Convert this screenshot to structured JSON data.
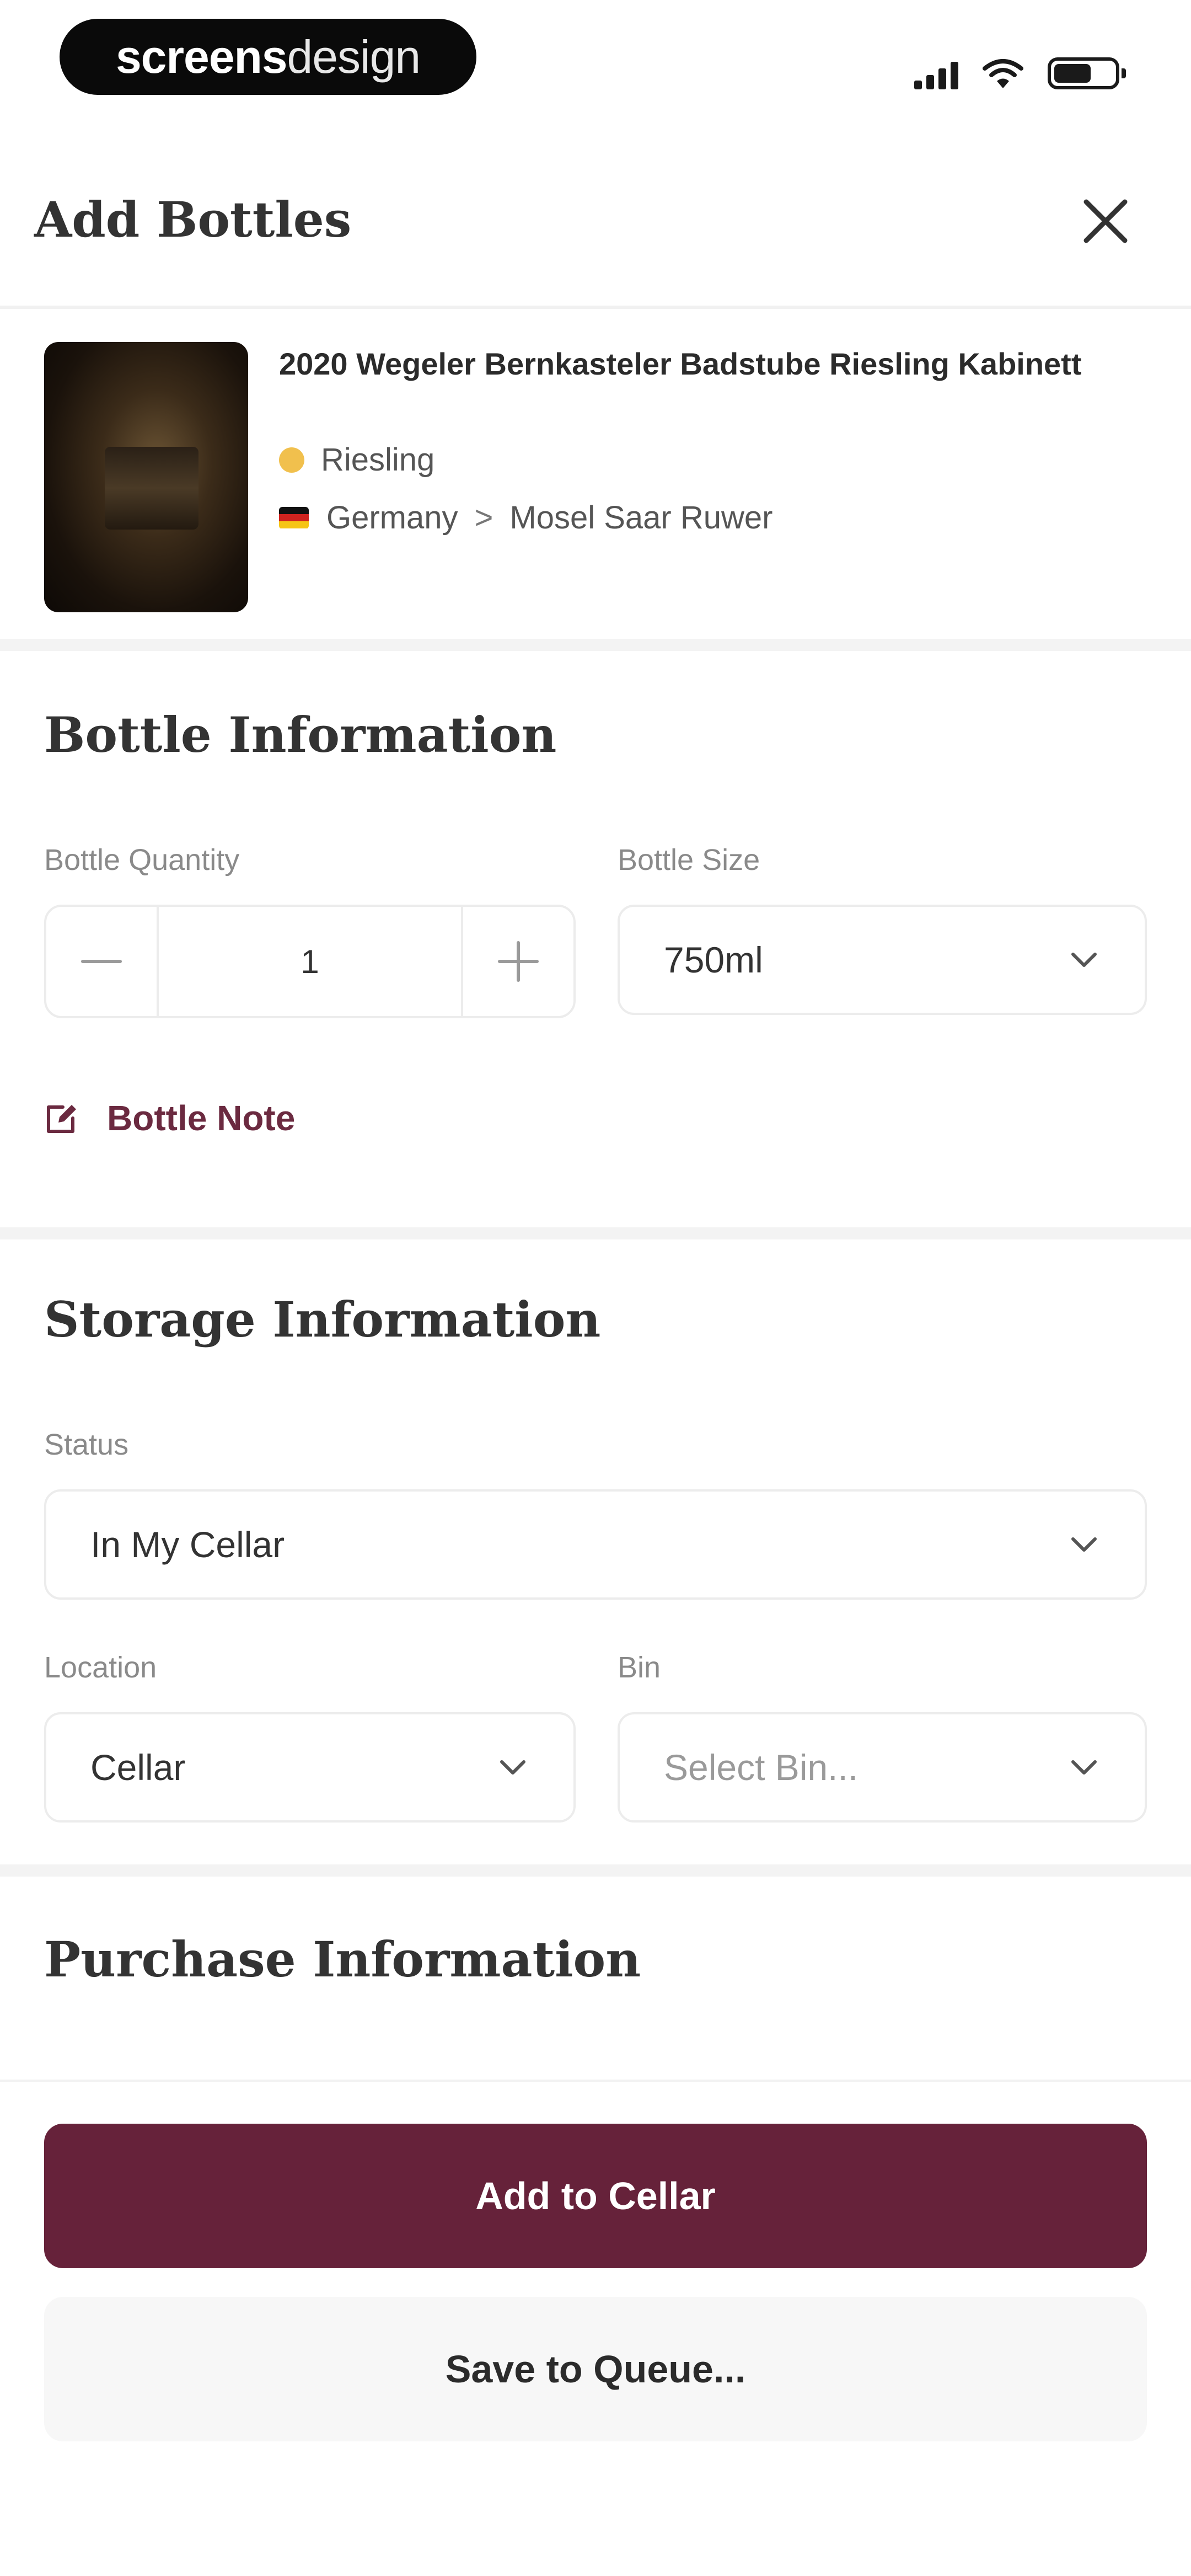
{
  "status_bar": {
    "brand_part1": "screens",
    "brand_part2": "design",
    "battery_level": 0.62
  },
  "header": {
    "title": "Add Bottles"
  },
  "wine": {
    "name": "2020 Wegeler Bernkasteler Badstube Riesling Kabinett",
    "varietal": "Riesling",
    "country": "Germany",
    "region_separator": ">",
    "region": "Mosel Saar Ruwer"
  },
  "bottle_info": {
    "title": "Bottle Information",
    "quantity_label": "Bottle Quantity",
    "quantity_value": "1",
    "size_label": "Bottle Size",
    "size_value": "750ml",
    "note_label": "Bottle Note"
  },
  "storage_info": {
    "title": "Storage Information",
    "status_label": "Status",
    "status_value": "In My Cellar",
    "location_label": "Location",
    "location_value": "Cellar",
    "bin_label": "Bin",
    "bin_placeholder": "Select Bin..."
  },
  "purchase_info": {
    "title": "Purchase Information"
  },
  "actions": {
    "primary_label": "Add to Cellar",
    "secondary_label": "Save to Queue..."
  },
  "colors": {
    "accent": "#66223a",
    "note_text": "#6b2a40",
    "varietal_dot": "#f1c04d"
  }
}
